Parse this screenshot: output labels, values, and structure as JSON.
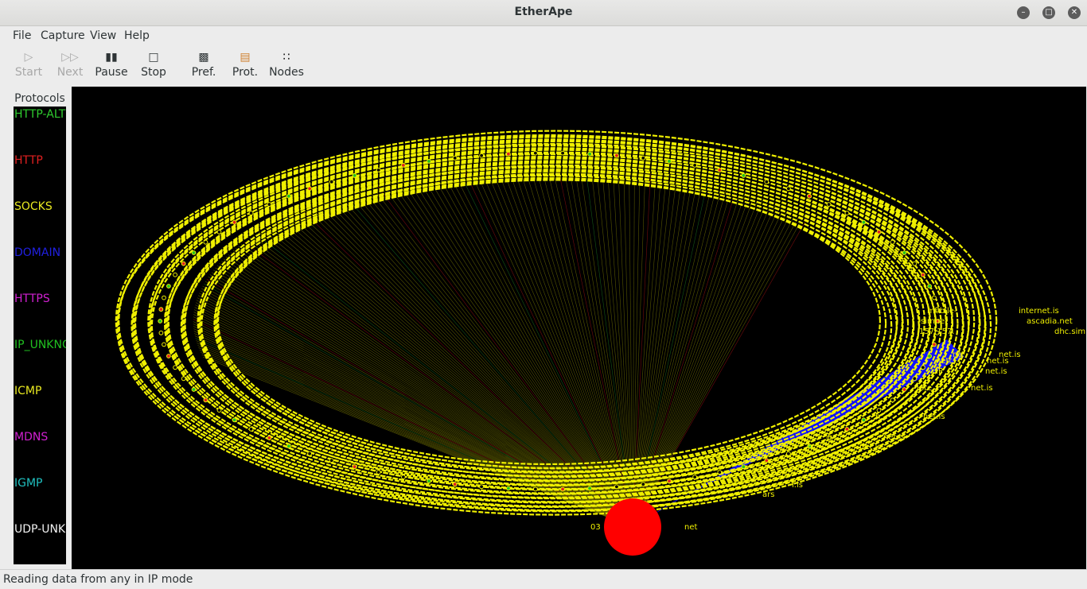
{
  "window": {
    "title": "EtherApe"
  },
  "menu": [
    "File",
    "Capture",
    "View",
    "Help"
  ],
  "toolbar": {
    "start": "Start",
    "next": "Next",
    "pause": "Pause",
    "stop": "Stop",
    "pref": "Pref.",
    "prot": "Prot.",
    "nodes": "Nodes"
  },
  "protocols": {
    "title": "Protocols",
    "items": [
      {
        "name": "HTTP-ALT",
        "color": "#2ecc2e"
      },
      {
        "name": "HTTP",
        "color": "#e02020"
      },
      {
        "name": "SOCKS",
        "color": "#e8e820"
      },
      {
        "name": "DOMAIN",
        "color": "#2020e0"
      },
      {
        "name": "HTTPS",
        "color": "#d020d0"
      },
      {
        "name": "IP_UNKNOWN",
        "color": "#20c020"
      },
      {
        "name": "ICMP",
        "color": "#e8e820"
      },
      {
        "name": "MDNS",
        "color": "#d020d0"
      },
      {
        "name": "IGMP",
        "color": "#20c0c0"
      },
      {
        "name": "UDP-UNKNOWN",
        "color": "#f0f0f0"
      }
    ]
  },
  "graph": {
    "node_labels": [
      "mobile-",
      "internet.is",
      "simnet",
      "ascadia.net",
      "157.157.",
      "dhc.simnet.is",
      "ne",
      "net.is",
      "nett",
      "net.is",
      "IP",
      "net.is",
      "inte",
      "net.is",
      "h",
      "net.is",
      "h",
      "net.is",
      "h",
      "net.is",
      "f.is",
      "ars",
      "03",
      "net"
    ],
    "colors": {
      "background": "#000000",
      "link": "#f0f000",
      "domain": "#1010ff",
      "center_node": "#ff0000"
    }
  },
  "status": "Reading data from any in IP mode"
}
